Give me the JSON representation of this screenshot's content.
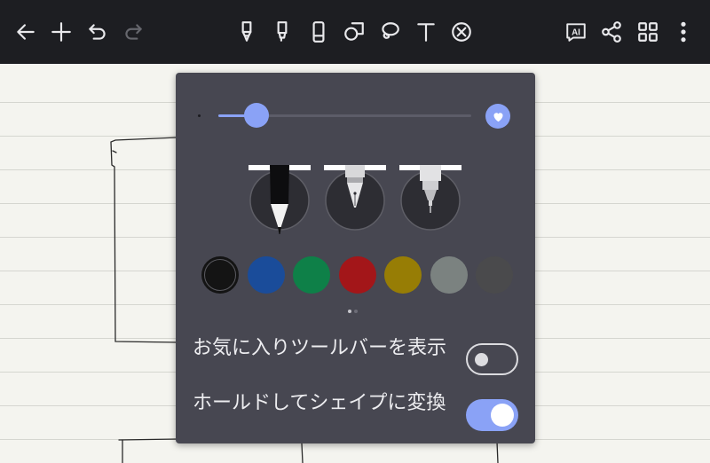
{
  "toolbar": {
    "left_icons": [
      "back-arrow-icon",
      "plus-icon",
      "undo-icon",
      "redo-icon"
    ],
    "tools": [
      "pen-icon",
      "highlighter-icon",
      "eraser-icon",
      "shapes-icon",
      "lasso-icon",
      "text-icon",
      "clear-icon"
    ],
    "right_icons": [
      "ai-icon",
      "share-icon",
      "grid-icon",
      "more-icon"
    ],
    "ai_label": "AI",
    "text_tool_label": "T"
  },
  "pen_settings": {
    "thickness_fraction": 0.15,
    "pen_types": [
      "ballpoint-pen",
      "fountain-pen",
      "technical-pen"
    ],
    "colors": [
      "#141414",
      "#1a4c9a",
      "#0e8048",
      "#a31619",
      "#977d05",
      "#7b8280",
      "#4a4a4c"
    ],
    "selected_color_index": 0,
    "page_count": 2,
    "active_page": 0,
    "settings": [
      {
        "label": "お気に入りツールバーを表示",
        "enabled": false
      },
      {
        "label": "ホールドしてシェイプに変換",
        "enabled": true
      }
    ]
  },
  "colors": {
    "toolbar_bg": "#1d1e22",
    "popup_bg": "#474751",
    "accent": "#8aa2f6",
    "paper": "#f4f4ef"
  }
}
